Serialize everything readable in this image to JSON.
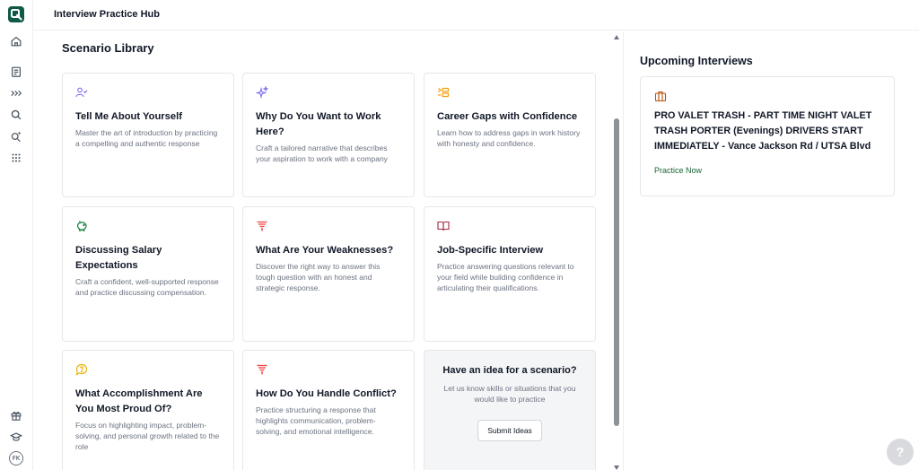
{
  "app": {
    "title": "Interview Practice Hub"
  },
  "colors": {
    "brand": "#0f5a46",
    "accent_purple": "#7c6cf2",
    "accent_orange": "#f59e0b",
    "accent_green": "#15803d",
    "accent_red": "#ef4444",
    "accent_maroon": "#9f2a42",
    "accent_yellow": "#eab308",
    "accent_brown": "#b45309"
  },
  "rail": {
    "items": [
      {
        "name": "home-icon"
      },
      {
        "name": "clipboard-icon"
      },
      {
        "name": "chevrons-right-icon"
      },
      {
        "name": "search-icon"
      },
      {
        "name": "search-sparkle-icon"
      },
      {
        "name": "apps-grid-icon"
      },
      {
        "name": "gift-icon"
      },
      {
        "name": "graduation-cap-icon"
      }
    ],
    "avatar": "FK"
  },
  "library": {
    "title": "Scenario Library",
    "cards": [
      {
        "title": "Tell Me About Yourself",
        "desc": "Master the art of introduction by practicing a compelling and authentic response",
        "icon": "user-check-icon"
      },
      {
        "title": "Why Do You Want to Work Here?",
        "desc": "Craft a tailored narrative that describes your aspiration to work with a company",
        "icon": "sparkles-icon"
      },
      {
        "title": "Career Gaps with Confidence",
        "desc": "Learn how to address gaps in work history with honesty and confidence.",
        "icon": "list-arrow-icon"
      },
      {
        "title": "Discussing Salary Expectations",
        "desc": "Craft a confident, well-supported response and practice discussing compensation.",
        "icon": "piggy-bank-icon"
      },
      {
        "title": "What Are Your Weaknesses?",
        "desc": "Discover the right way to answer this tough question with an honest and strategic response.",
        "icon": "filter-funnel-icon"
      },
      {
        "title": "Job-Specific Interview",
        "desc": "Practice answering questions relevant to your field while building confidence in articulating their qualifications.",
        "icon": "book-open-icon"
      },
      {
        "title": "What Accomplishment Are You Most Proud Of?",
        "desc": "Focus on highlighting impact, problem-solving, and personal growth related to the role",
        "icon": "message-question-icon"
      },
      {
        "title": "How Do You Handle Conflict?",
        "desc": "Practice structuring a response that highlights communication, problem-solving, and emotional intelligence.",
        "icon": "filter-funnel-icon"
      }
    ],
    "idea": {
      "title": "Have an idea for a scenario?",
      "desc": "Let us know skills or situations that you would like to practice",
      "button": "Submit Ideas"
    }
  },
  "upcoming": {
    "title": "Upcoming Interviews",
    "job": {
      "title": "PRO VALET TRASH - PART TIME NIGHT VALET TRASH PORTER (Evenings) DRIVERS START IMMEDIATELY - Vance Jackson Rd / UTSA Blvd",
      "action": "Practice Now",
      "icon": "briefcase-icon"
    }
  },
  "help": {
    "label": "?"
  }
}
